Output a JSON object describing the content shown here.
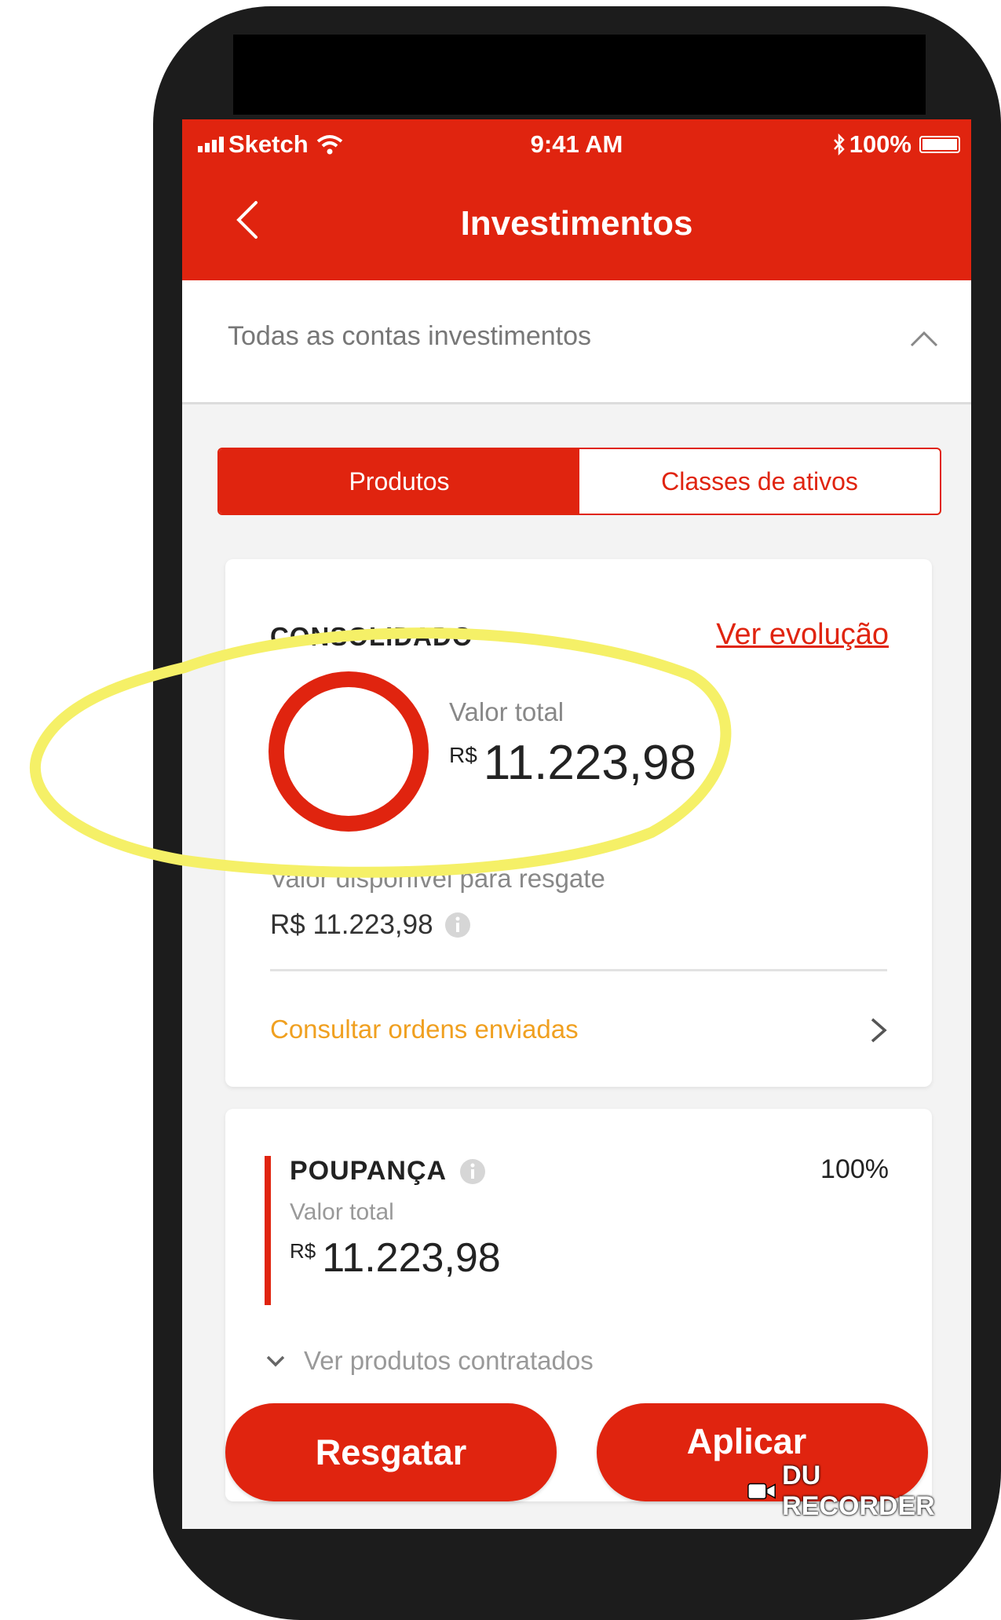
{
  "status_bar": {
    "carrier": "Sketch",
    "time": "9:41 AM",
    "battery": "100%"
  },
  "header": {
    "title": "Investimentos"
  },
  "account_selector": {
    "label": "Todas as contas investimentos"
  },
  "tabs": [
    {
      "label": "Produtos",
      "active": true
    },
    {
      "label": "Classes de ativos",
      "active": false
    }
  ],
  "consolidated": {
    "title": "CONSOLIDADO",
    "link": "Ver evolução",
    "total_label": "Valor total",
    "currency": "R$",
    "total_value": "11.223,98",
    "available_label": "Valor disponível para resgate",
    "available_value": "R$ 11.223,98",
    "orders_link": "Consultar ordens enviadas"
  },
  "product": {
    "title": "POUPANÇA",
    "percent": "100%",
    "total_label": "Valor total",
    "currency": "R$",
    "total_value": "11.223,98",
    "expand_label": "Ver produtos contratados"
  },
  "actions": {
    "redeem": "Resgatar",
    "apply": "Aplicar"
  },
  "watermark": "DU RECORDER",
  "colors": {
    "brand_red": "#e0240f",
    "orders_link": "#f0a020",
    "highlight": "#f5f067"
  }
}
